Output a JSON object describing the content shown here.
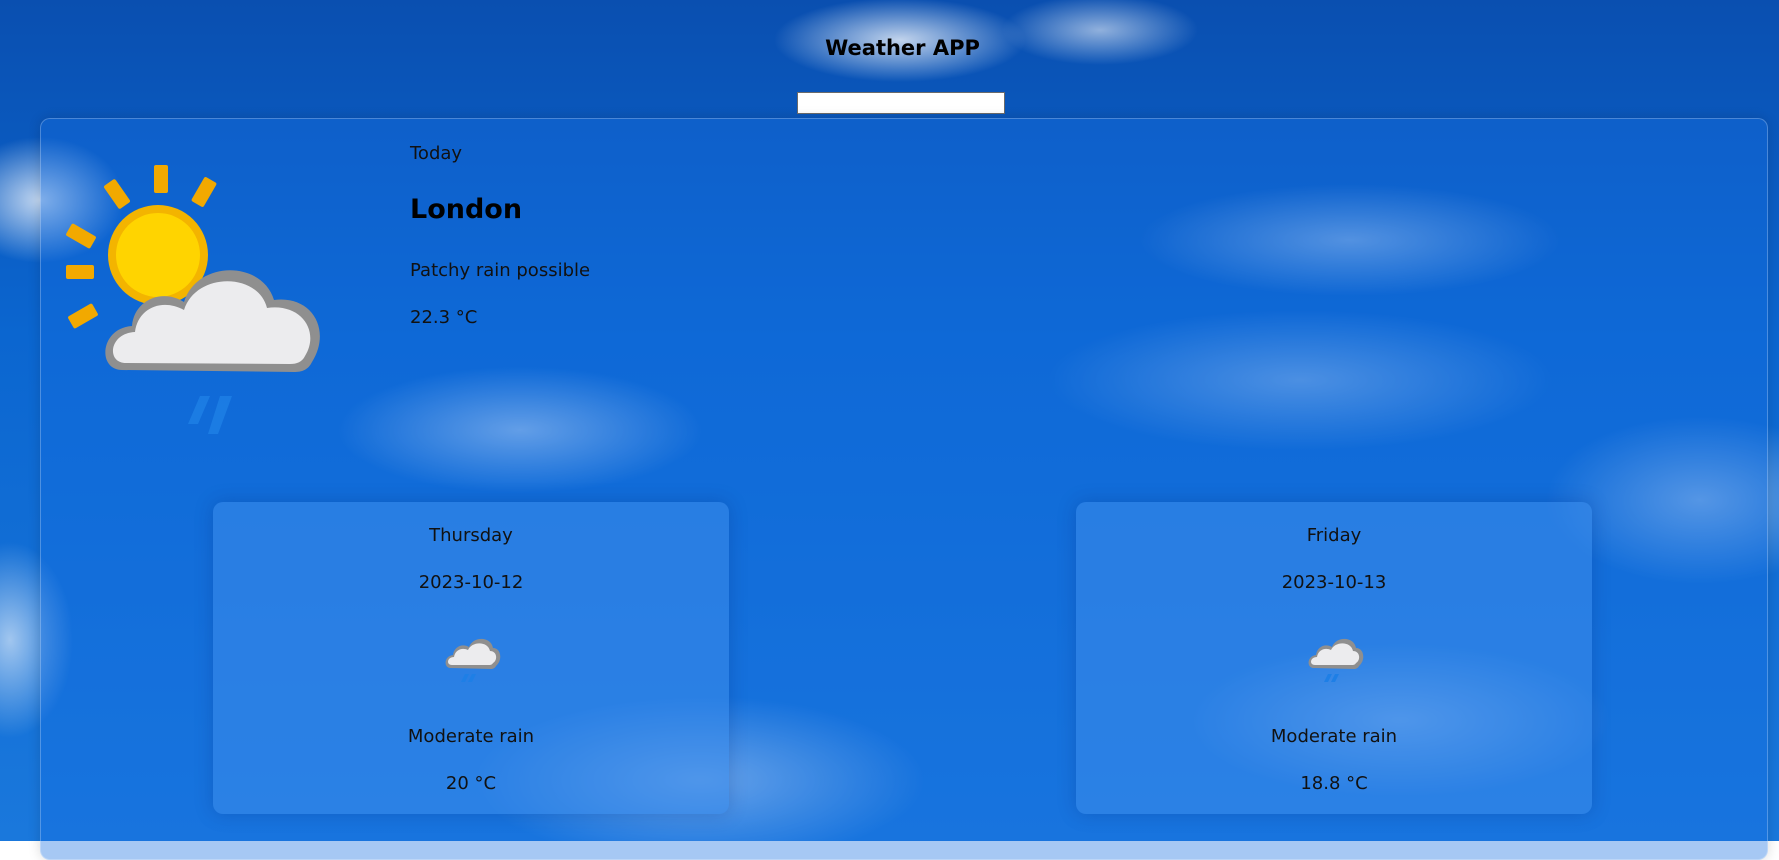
{
  "app": {
    "title": "Weather APP"
  },
  "search": {
    "value": "",
    "placeholder": ""
  },
  "today": {
    "label": "Today",
    "city": "London",
    "condition": "Patchy rain possible",
    "temperature": "22.3 °C",
    "icon": "sun-cloud-rain-icon"
  },
  "forecast": [
    {
      "day": "Thursday",
      "date": "2023-10-12",
      "condition": "Moderate rain",
      "temperature": "20 °C",
      "icon": "cloud-rain-icon"
    },
    {
      "day": "Friday",
      "date": "2023-10-13",
      "condition": "Moderate rain",
      "temperature": "18.8 °C",
      "icon": "cloud-rain-icon"
    }
  ],
  "colors": {
    "sky": "#0b66d0",
    "sun": "#f5c400",
    "rain": "#1e90ff"
  }
}
